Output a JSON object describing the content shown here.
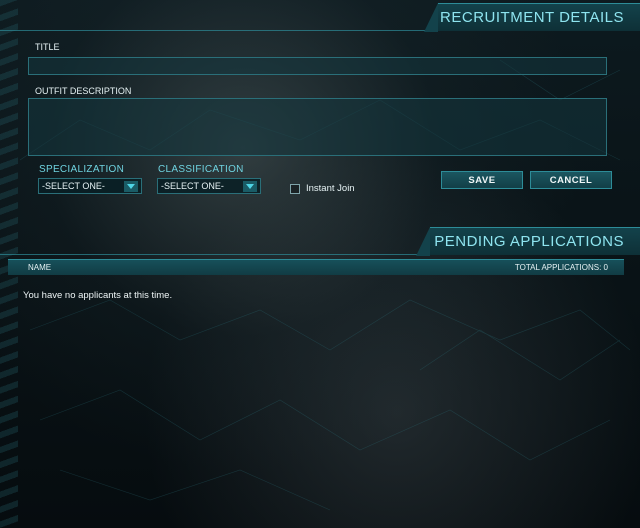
{
  "recruitment": {
    "header": "RECRUITMENT DETAILS",
    "title_label": "TITLE",
    "title_value": "",
    "description_label": "OUTFIT DESCRIPTION",
    "description_value": "",
    "specialization_label": "SPECIALIZATION",
    "specialization_value": "-SELECT ONE-",
    "classification_label": "CLASSIFICATION",
    "classification_value": "-SELECT ONE-",
    "instant_join_label": "Instant Join",
    "instant_join_checked": false,
    "save_label": "SAVE",
    "cancel_label": "CANCEL"
  },
  "pending": {
    "header": "PENDING APPLICATIONS",
    "col_name": "NAME",
    "total_label": "TOTAL APPLICATIONS: 0",
    "empty_message": "You have no applicants at this time."
  },
  "colors": {
    "accent": "#2d8c98",
    "header_text": "#8ee4ef",
    "label_cyan": "#6fd3e0"
  }
}
